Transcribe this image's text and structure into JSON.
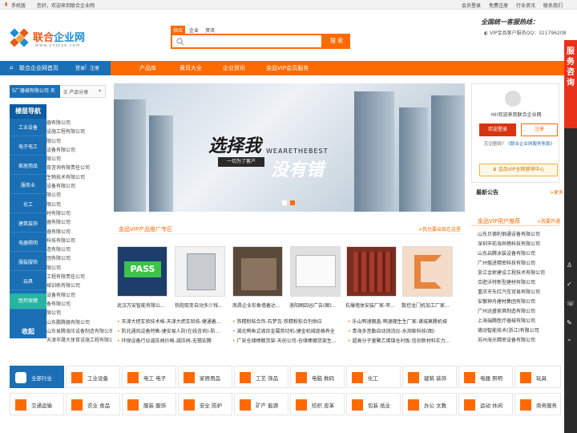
{
  "topbar": {
    "mobile": "手机版",
    "greeting": "您好，欢迎来到联合企业网",
    "links": [
      "会员登录",
      "免费注册",
      "行业资讯",
      "联系我们"
    ]
  },
  "logo": {
    "name_a": "联合",
    "name_b": "企业网",
    "url": "www.unqiye.com"
  },
  "search": {
    "tabs": [
      "供应",
      "企业",
      "资讯"
    ],
    "placeholder": "",
    "button": "搜 索"
  },
  "hotline": {
    "title": "全国统一客服热线：",
    "vip_qq": "VIP金品客户服务QQ：321796208"
  },
  "nav": {
    "home": "联合企业网首页",
    "login": "登录",
    "register": "注册",
    "items": [
      "产品库",
      "黄页大全",
      "企业资讯",
      "金品VIP会员服务"
    ]
  },
  "side_ad": {
    "text": "服务咨询"
  },
  "category_bar": {
    "selected": "5厂器械有限公司 天",
    "label": "产品分类"
  },
  "left_nav": {
    "title": "楼层导航",
    "items": [
      "工业设备",
      "电子电工",
      "家居用品",
      "服务业",
      "化工",
      "建筑装饰",
      "电器照明",
      "服装服饰",
      "玩具",
      "医药保健"
    ],
    "footer": "收起"
  },
  "company_list": [
    "器有限公司",
    "设施工程有限公司",
    "限公司",
    "设备有限公司",
    "限公司",
    "育咨询有限责任公司",
    "生物技术有限公司",
    "设备有限公司",
    "限公司",
    "限公司",
    "材有限公司",
    "器有限公司",
    "器有限公司",
    "科技有限公司",
    "造有限公司",
    "团有限公司",
    "限公司",
    "工程有限责任公司",
    "械训练有限公司",
    "设备有限公司",
    "备有限公司",
    "限公司",
    "山东鹏腾器有限公司",
    "山东易腾液压设备制造有限公司",
    "天津市晟大体育设施工程有限公司"
  ],
  "banner": {
    "headline": "选择我",
    "headline2": "没有错",
    "slogan_en": "WEARETHEBEST",
    "tagline": "一切为了客户"
  },
  "vip_section": {
    "title": "金品VIP产品推广专区",
    "more": ">我也要出现在这里"
  },
  "products": [
    {
      "caption": "武汉万安智能有限公..."
    },
    {
      "caption": "热阻取变自动多少钱..."
    },
    {
      "caption": "南昌企业形象墙着达..."
    },
    {
      "caption": "洛阳图四谷广告(图)..."
    },
    {
      "caption": "抗爆墙体安装厂家-苹..."
    },
    {
      "caption": "数控龙门机加工厂家..."
    }
  ],
  "news_col1": [
    "天津大把车验技术格-天津大把车验技-捷通着...",
    "防北通风设备特售-捷安易人防(在线咨询)-防...",
    "环保设备行业减压阀价格-减压阀-无锡宏腾"
  ],
  "news_col2": [
    "铁精粉粘合剂-石梦克-铁精粉粘合剂供应",
    "湖北鸭鱼式液压金属剪切机-捷金机械现格养全",
    "广安仓储棒棚货架-天创公司-仓储棒棚货架生..."
  ],
  "news_col3": [
    "乐山鸭速棚盖-鸭速棚生生厂家-诸城莫腾机械",
    "青海多音勤自动测流仪-水测家科技(图)",
    "超高分子量聚乙烯煤仓衬板-信创新材料实力..."
  ],
  "right_panel": {
    "greeting": "HI!欢迎来到联合企业网",
    "login": "欢迎登录",
    "register": "注册",
    "forgot": "忘记密码？",
    "vip_link": "《联合企业网服务条款》",
    "vip_button": "金品VIP全网营销中心",
    "announcement": "最新公告",
    "ann_more": ">更多"
  },
  "recommend": {
    "title": "金品VIP用户推荐",
    "more": ">我要开通",
    "items": [
      "山东贝德利钢通设备有限公司",
      "深圳市前海异畅科技有限公司",
      "山东启腾泳装设备有限公司",
      "广州俄进精密科技有限公司",
      "浙江金射建设工程技术有限公司",
      "合肥沃特新型建材有限公司",
      "重庆市东红汽车贸易有限公司",
      "安徽神舟建材集团有限公司",
      "广州迅盛家具制造有限公司",
      "上海瑞腾医疗器械有限公司",
      "德动智能技术(浙江)有限公司",
      "苏州海光精密设备有限公司"
    ]
  },
  "industries": [
    [
      "全部行业",
      "工业设备",
      "电工 电子",
      "家居用品",
      "工艺 饰品",
      "电脑 数码",
      "化工",
      "建筑 装饰",
      "电器 照明",
      "玩具"
    ],
    [
      "交通运输",
      "农业 食品",
      "服装 服饰",
      "安全 防护",
      "矿产 能源",
      "纺织 皮革",
      "包装 纸业",
      "办公 文教",
      "运动 休闲",
      "商务服务"
    ]
  ],
  "colors": {
    "accent": "#ff6a00",
    "brand_blue": "#1a6fb5",
    "red": "#d8350f"
  }
}
